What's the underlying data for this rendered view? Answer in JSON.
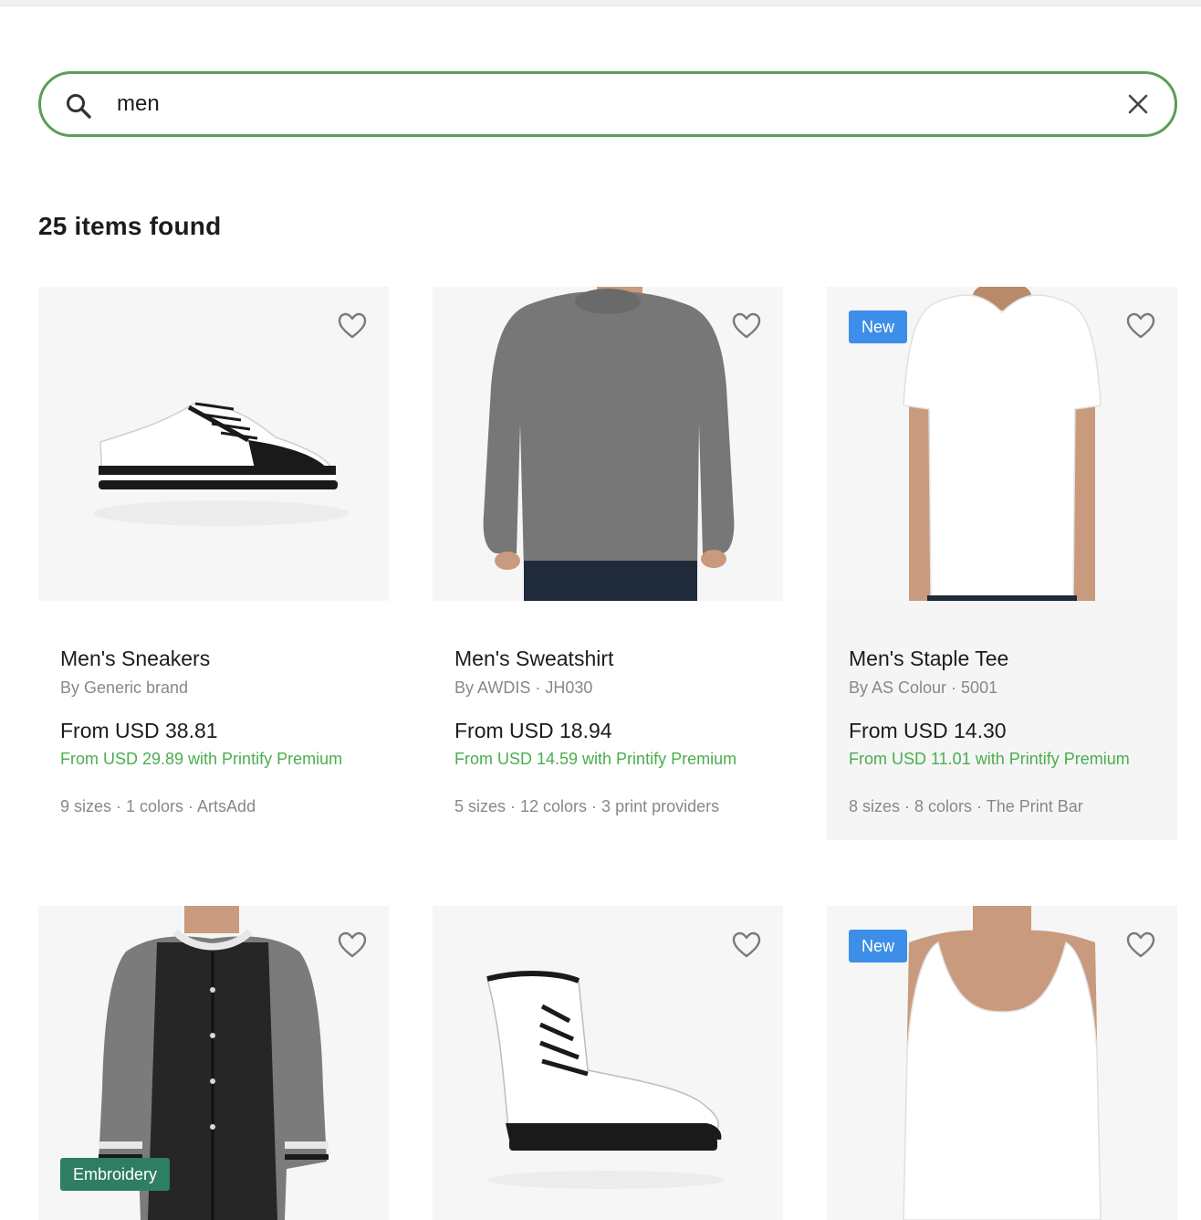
{
  "search": {
    "value": "men",
    "placeholder": "Search"
  },
  "results_label": "25 items found",
  "colors": {
    "search_border": "#5a9e5a",
    "premium_green": "#4aae4e",
    "badge_new": "#3d8ee8",
    "badge_embroidery": "#2e7d65"
  },
  "products": [
    {
      "name": "Men's Sneakers",
      "brand": "By Generic brand",
      "price": "From USD 38.81",
      "premium": "From USD 29.89 with Printify Premium",
      "meta": "9 sizes · 1 colors · ArtsAdd",
      "icon": "sneaker"
    },
    {
      "name": "Men's Sweatshirt",
      "brand": "By AWDIS · JH030",
      "price": "From USD 18.94",
      "premium": "From USD 14.59 with Printify Premium",
      "meta": "5 sizes · 12 colors · 3 print providers",
      "icon": "sweatshirt"
    },
    {
      "name": "Men's Staple Tee",
      "brand": "By AS Colour · 5001",
      "price": "From USD 14.30",
      "premium": "From USD 11.01 with Printify Premium",
      "meta": "8 sizes · 8 colors · The Print Bar",
      "badge": "New",
      "icon": "t-shirt"
    },
    {
      "badge": "Embroidery",
      "icon": "varsity-jacket"
    },
    {
      "icon": "boot"
    },
    {
      "badge": "New",
      "icon": "tank-top"
    }
  ]
}
